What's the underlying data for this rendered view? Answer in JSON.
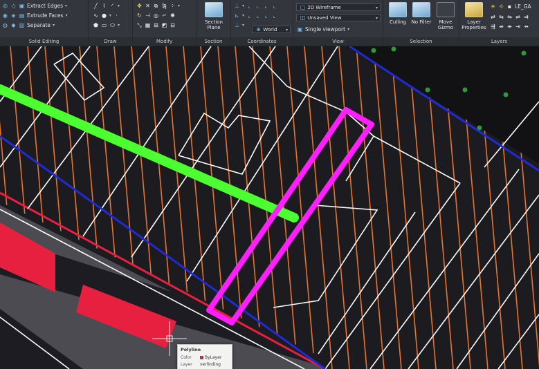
{
  "ribbon": {
    "solid_editing": {
      "title": "Solid Editing",
      "extract_edges": "Extract Edges",
      "extrude_faces": "Extrude Faces",
      "separate": "Separate"
    },
    "draw": {
      "title": "Draw"
    },
    "modify": {
      "title": "Modify"
    },
    "section": {
      "title": "Section",
      "section_plane_line1": "Section",
      "section_plane_line2": "Plane"
    },
    "coordinates": {
      "title": "Coordinates",
      "ucs_value": "World"
    },
    "view": {
      "title": "View",
      "visual_style": "2D Wireframe",
      "named_view": "Unsaved View",
      "viewport": "Single viewport"
    },
    "selection": {
      "title": "Selection",
      "culling": "Culling",
      "no_filter": "No Filter",
      "move_gizmo_line1": "Move",
      "move_gizmo_line2": "Gizmo"
    },
    "layers": {
      "title": "Layers",
      "layer_properties_line1": "Layer",
      "layer_properties_line2": "Properties",
      "current_layer": "LE_GA"
    }
  },
  "tooltip": {
    "title": "Polyline",
    "rows": [
      {
        "key": "Color",
        "value": "ByLayer"
      },
      {
        "key": "Layer",
        "value": "verlinding"
      }
    ]
  },
  "colors": {
    "background": "#1c1c20",
    "hatch": "#e8742e",
    "outline": "#ffffff",
    "road_edge": "#1f2bd4",
    "highlight": "#ff1fff",
    "green_line": "#4cff30",
    "red_blocks": "#e8203f",
    "road_fill": "#4d4b52",
    "point_markers": "#2d9a3a"
  }
}
